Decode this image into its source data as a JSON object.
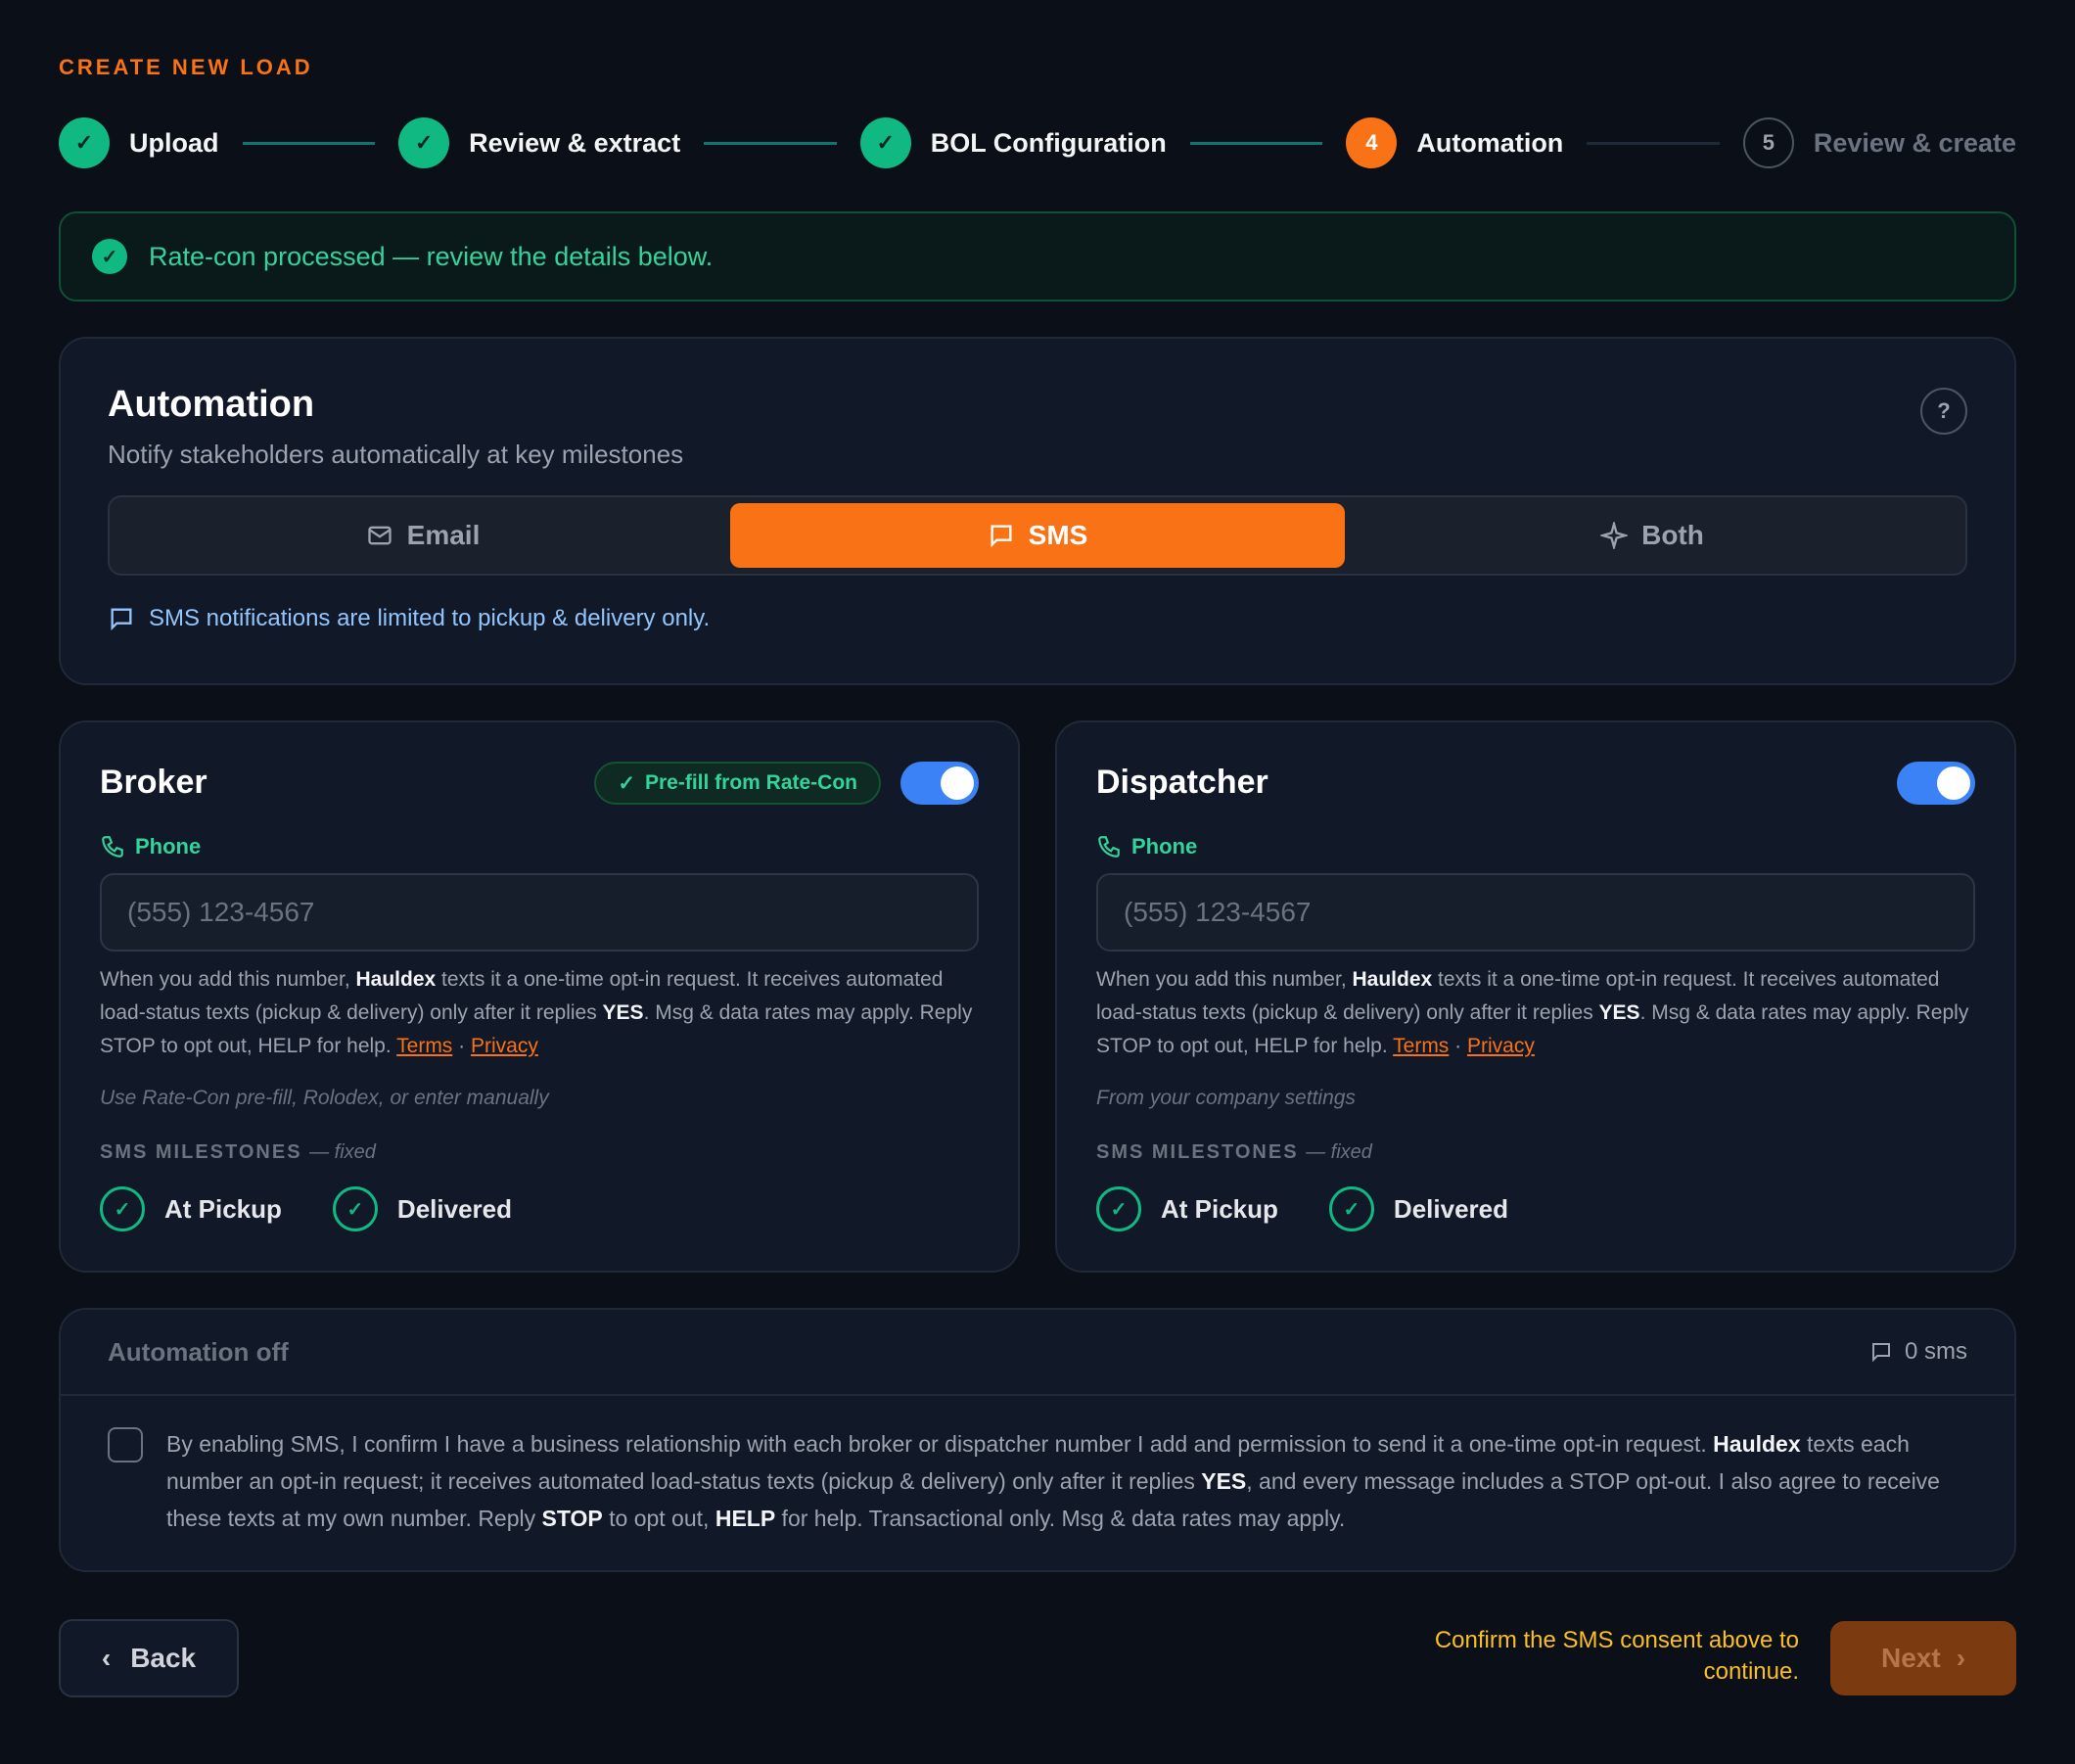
{
  "header": {
    "eyebrow": "CREATE NEW LOAD"
  },
  "stepper": {
    "steps": [
      {
        "label": "Upload",
        "state": "done",
        "marker": "✓"
      },
      {
        "label": "Review & extract",
        "state": "done",
        "marker": "✓"
      },
      {
        "label": "BOL Configuration",
        "state": "done",
        "marker": "✓"
      },
      {
        "label": "Automation",
        "state": "active",
        "marker": "4"
      },
      {
        "label": "Review & create",
        "state": "todo",
        "marker": "5"
      }
    ]
  },
  "banner": {
    "text": "Rate-con processed — review the details below.",
    "icon": "check-icon"
  },
  "automation": {
    "title": "Automation",
    "subtitle": "Notify stakeholders automatically at key milestones",
    "help": "?",
    "channels": [
      {
        "label": "Email",
        "icon": "mail-icon",
        "selected": false
      },
      {
        "label": "SMS",
        "icon": "message-icon",
        "selected": true
      },
      {
        "label": "Both",
        "icon": "sparkle-icon",
        "selected": false
      }
    ],
    "note": "SMS notifications are limited to pickup & delivery only."
  },
  "broker": {
    "title": "Broker",
    "prefill": "Pre-fill from Rate-Con",
    "toggle_on": true,
    "phone_label": "Phone",
    "phone_placeholder": "(555) 123-4567",
    "consent_1": "When you add this number, ",
    "brand": "Hauldex",
    "consent_2": " texts it a one-time opt-in request. It receives automated load-status texts (pickup & delivery) only after it replies ",
    "yes": "YES",
    "consent_3": ". Msg & data rates may apply. Reply STOP to opt out, HELP for help. ",
    "terms": "Terms",
    "sep": " · ",
    "privacy": "Privacy",
    "hint": "Use Rate-Con pre-fill, Rolodex, or enter manually",
    "milestones_label": "SMS MILESTONES",
    "milestones_fixed": "— fixed",
    "milestones": [
      "At Pickup",
      "Delivered"
    ]
  },
  "dispatcher": {
    "title": "Dispatcher",
    "toggle_on": true,
    "phone_label": "Phone",
    "phone_placeholder": "(555) 123-4567",
    "consent_1": "When you add this number, ",
    "brand": "Hauldex",
    "consent_2": " texts it a one-time opt-in request. It receives automated load-status texts (pickup & delivery) only after it replies ",
    "yes": "YES",
    "consent_3": ". Msg & data rates may apply. Reply STOP to opt out, HELP for help. ",
    "terms": "Terms",
    "sep": " · ",
    "privacy": "Privacy",
    "hint": "From your company settings",
    "milestones_label": "SMS MILESTONES",
    "milestones_fixed": "— fixed",
    "milestones": [
      "At Pickup",
      "Delivered"
    ]
  },
  "summary": {
    "title": "Automation off",
    "count": "0 sms",
    "checked": false,
    "c1": "By enabling SMS, I confirm I have a business relationship with each broker or dispatcher number I add and permission to send it a one-time opt-in request. ",
    "brand": "Hauldex",
    "c2": " texts each number an opt-in request; it receives automated load-status texts (pickup & delivery) only after it replies ",
    "yes": "YES",
    "c3": ", and every message includes a STOP opt-out. I also agree to receive these texts at my own number. Reply ",
    "stop": "STOP",
    "c4": " to opt out, ",
    "help": "HELP",
    "c5": " for help. Transactional only. Msg & data rates may apply."
  },
  "footer": {
    "back": "Back",
    "warning": "Confirm the SMS consent above to continue.",
    "next": "Next"
  },
  "colors": {
    "accent": "#f97316",
    "success": "#10b981",
    "toggle": "#3b82f6",
    "warning": "#fbbf24"
  }
}
